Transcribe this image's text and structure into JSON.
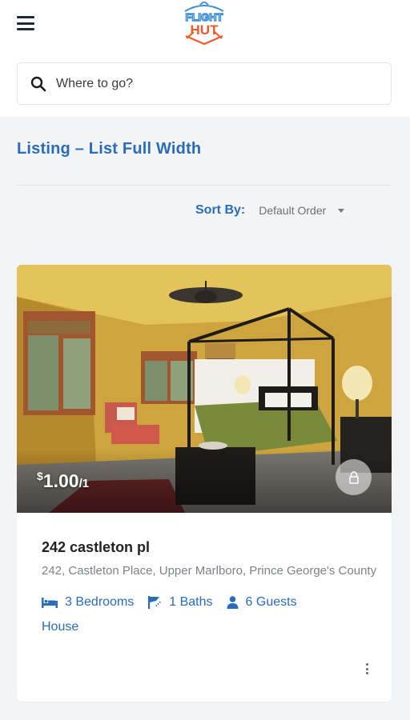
{
  "header": {
    "logo_top": "FLIGHT",
    "logo_bottom": "HUT",
    "menu_icon": "hamburger-menu-icon"
  },
  "search": {
    "placeholder": "Where to go?",
    "value": "",
    "icon": "search-icon"
  },
  "page": {
    "title": "Listing – List Full Width"
  },
  "sort": {
    "label": "Sort By:",
    "selected": "Default Order"
  },
  "listing": {
    "price_currency": "$",
    "price_amount": "1.00",
    "price_unit": "/1",
    "title": "242 castleton pl",
    "address": "242, Castleton Place, Upper Marlboro, Prince George's County",
    "bedrooms": "3 Bedrooms",
    "baths": "1 Baths",
    "guests": "6 Guests",
    "type": "House"
  },
  "colors": {
    "accent": "#2b6cb8",
    "logo_blue": "#3f8fd6",
    "logo_orange": "#f05a28",
    "background": "#f3f4f6"
  }
}
